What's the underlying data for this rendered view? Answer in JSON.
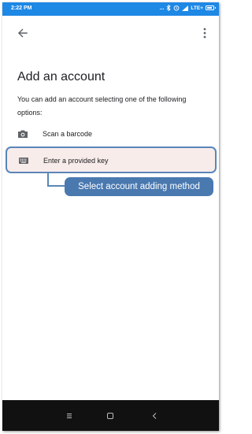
{
  "status_bar": {
    "time": "2:22 PM",
    "dots": "...",
    "network": "LTE+",
    "icons": [
      "bluetooth-icon",
      "alarm-icon",
      "signal-icon",
      "battery-icon"
    ],
    "battery_level": 0.85
  },
  "app_bar": {
    "back_icon": "arrow-left-icon",
    "menu_icon": "more-vert-icon"
  },
  "main": {
    "title": "Add an account",
    "description": "You can add an account selecting one of the following options:",
    "options": [
      {
        "label": "Scan a barcode",
        "icon": "camera-icon"
      },
      {
        "label": "Enter a provided key",
        "icon": "keyboard-icon"
      }
    ]
  },
  "annotation": {
    "callout_text": "Select account adding method"
  },
  "nav_bar": {
    "icons": [
      "menu-icon",
      "home-icon",
      "back-icon"
    ]
  },
  "colors": {
    "status_bar": "#1e88e5",
    "highlight_border": "#5a86b8",
    "highlight_fill": "#f8ecea",
    "callout_bg": "#4a79b0",
    "nav_bar": "#111111"
  }
}
